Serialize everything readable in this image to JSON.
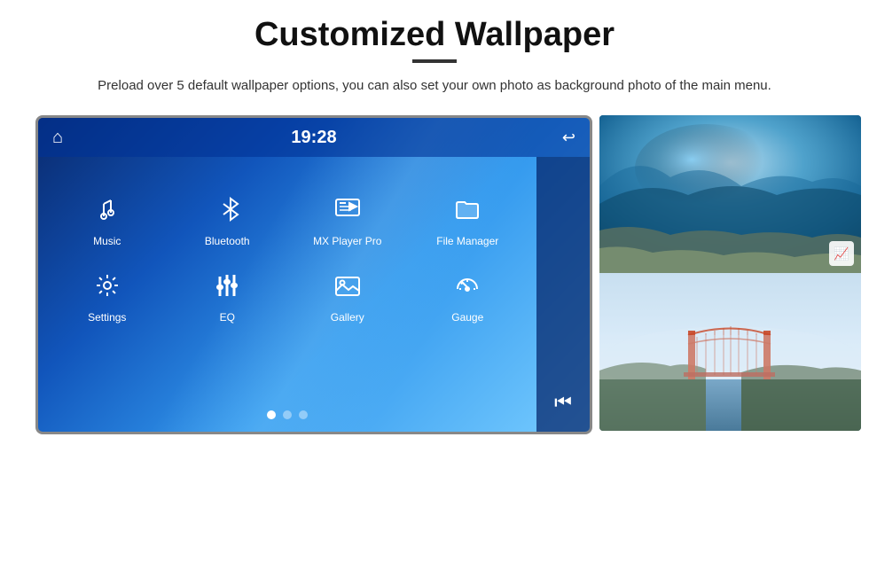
{
  "header": {
    "title": "Customized Wallpaper",
    "subtitle": "Preload over 5 default wallpaper options, you can also set your own photo as background photo of the main menu."
  },
  "screen": {
    "time": "19:28",
    "apps": [
      {
        "id": "music",
        "label": "Music",
        "icon": "music-note"
      },
      {
        "id": "bluetooth",
        "label": "Bluetooth",
        "icon": "bluetooth"
      },
      {
        "id": "mx-player",
        "label": "MX Player Pro",
        "icon": "video-player"
      },
      {
        "id": "file-manager",
        "label": "File Manager",
        "icon": "folder"
      },
      {
        "id": "settings",
        "label": "Settings",
        "icon": "settings"
      },
      {
        "id": "eq",
        "label": "EQ",
        "icon": "equalizer"
      },
      {
        "id": "gallery",
        "label": "Gallery",
        "icon": "gallery"
      },
      {
        "id": "gauge",
        "label": "Gauge",
        "icon": "gauge"
      }
    ],
    "dots": [
      {
        "active": true
      },
      {
        "active": false
      },
      {
        "active": false
      }
    ]
  },
  "photos": {
    "top_alt": "Ice cave blue",
    "bottom_alt": "Golden Gate Bridge"
  },
  "colors": {
    "accent": "#1155bb",
    "text_dark": "#111111",
    "text_medium": "#333333"
  }
}
